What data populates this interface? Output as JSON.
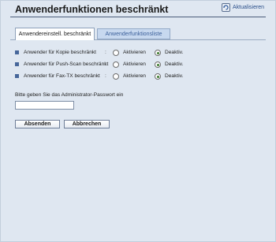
{
  "page": {
    "title": "Anwenderfunktionen beschränkt",
    "refresh_label": "Aktualisieren"
  },
  "tabs": [
    {
      "label": "Anwendereinstell. beschränkt",
      "active": true
    },
    {
      "label": "Anwenderfunktionsliste",
      "active": false
    }
  ],
  "settings": {
    "separator": ":",
    "enable_label": "Aktivieren",
    "disable_label": "Deaktiv.",
    "rows": [
      {
        "label": "Anwender für Kopie beschränkt",
        "selected": "disable"
      },
      {
        "label": "Anwender für Push-Scan beschränkt",
        "selected": "disable"
      },
      {
        "label": "Anwender für Fax-TX beschränkt",
        "selected": "disable"
      }
    ]
  },
  "password": {
    "prompt": "Bitte geben Sie das Administrator-Passwort ein",
    "value": ""
  },
  "buttons": {
    "submit_label": "Absenden",
    "cancel_label": "Abbrechen"
  },
  "colors": {
    "background": "#dfe7f1",
    "bullet": "#46669a",
    "link": "#2a4f8a",
    "inactive_tab": "#c7d8ef"
  }
}
